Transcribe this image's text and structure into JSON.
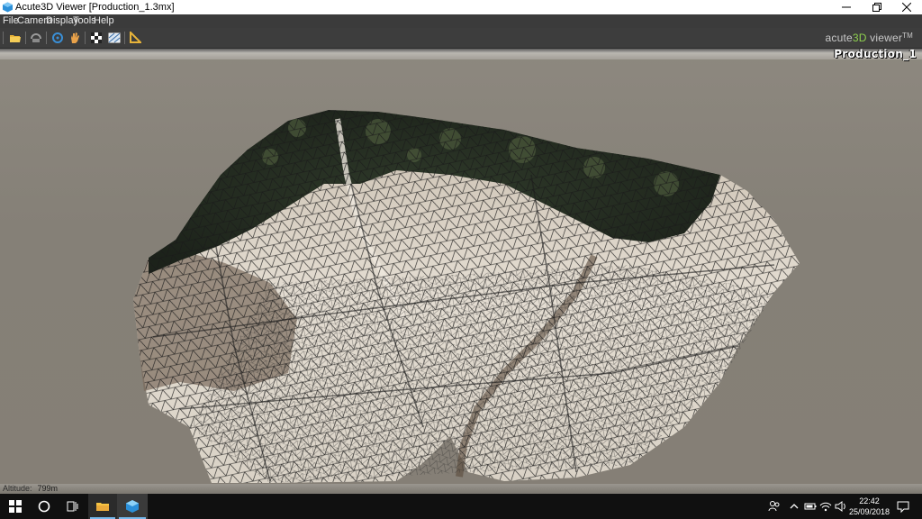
{
  "window": {
    "title": "Acute3D Viewer [Production_1.3mx]"
  },
  "menu": {
    "items": [
      "File",
      "Camera",
      "Display",
      "Tools",
      "Help"
    ]
  },
  "brand": {
    "text_a": "acute",
    "text_b": "3D",
    "text_c": " viewer",
    "tm": "TM"
  },
  "viewport": {
    "production_label": "Production_1"
  },
  "status": {
    "altitude_label": "Altitude:",
    "altitude_value": "799m"
  },
  "toolbar": {
    "icons": [
      "open-folder-icon",
      "home-icon",
      "orbit-icon",
      "pan-hand-icon",
      "checker-texture-icon",
      "wireframe-icon",
      "measure-icon"
    ]
  },
  "taskbar": {
    "time": "22:42",
    "date": "25/09/2018"
  },
  "colors": {
    "menubar_bg": "#3b3b3b",
    "viewport_bg": "#858077",
    "brand_accent": "#8fd14f",
    "taskbar_bg": "#101010"
  }
}
